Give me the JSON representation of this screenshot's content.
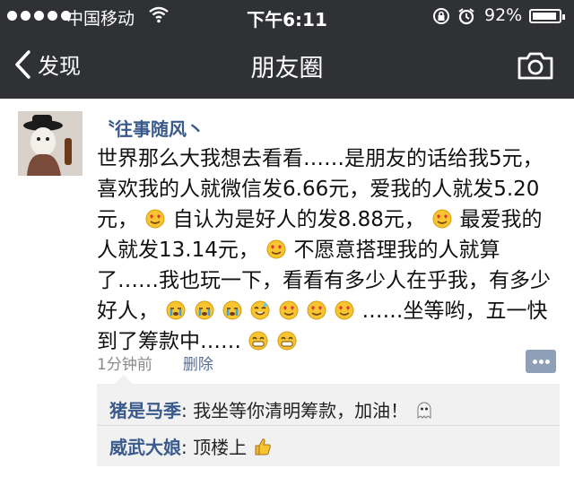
{
  "status_bar": {
    "carrier": "中国移动",
    "time": "下午6:11",
    "battery_percent": "92%",
    "battery_level": 0.92,
    "icons": [
      "signal-dots",
      "wifi-icon",
      "rotation-lock-icon",
      "alarm-icon",
      "battery-icon"
    ]
  },
  "nav": {
    "back_label": "发现",
    "title": "朋友圈",
    "right_icon": "camera-icon"
  },
  "post": {
    "username": "〝往事随风丶",
    "text_segments": [
      "世界那么大我想去看看……是朋友的话给我5元，喜欢我的人就微信发6.66元，爱我的人就发5.20元，",
      "自认为是好人的发8.88元，",
      "最爱我的人就发13.14元，",
      "不愿意搭理我的人就算了……我也玩一下，看看有多少人在乎我，有多少好人，",
      "……坐等哟，五一快到了筹款中……"
    ],
    "time_ago": "1分钟前",
    "delete_label": "删除"
  },
  "comments": [
    {
      "name": "猪是马季",
      "separator": ": ",
      "text": "我坐等你清明筹款，加油！"
    },
    {
      "name": "威武大娘",
      "separator": ": ",
      "text": "顶楼上"
    }
  ],
  "colors": {
    "bar_bg": "#2f3135",
    "link_blue": "#3a5a8c",
    "comment_bg": "#f1f1f1"
  }
}
